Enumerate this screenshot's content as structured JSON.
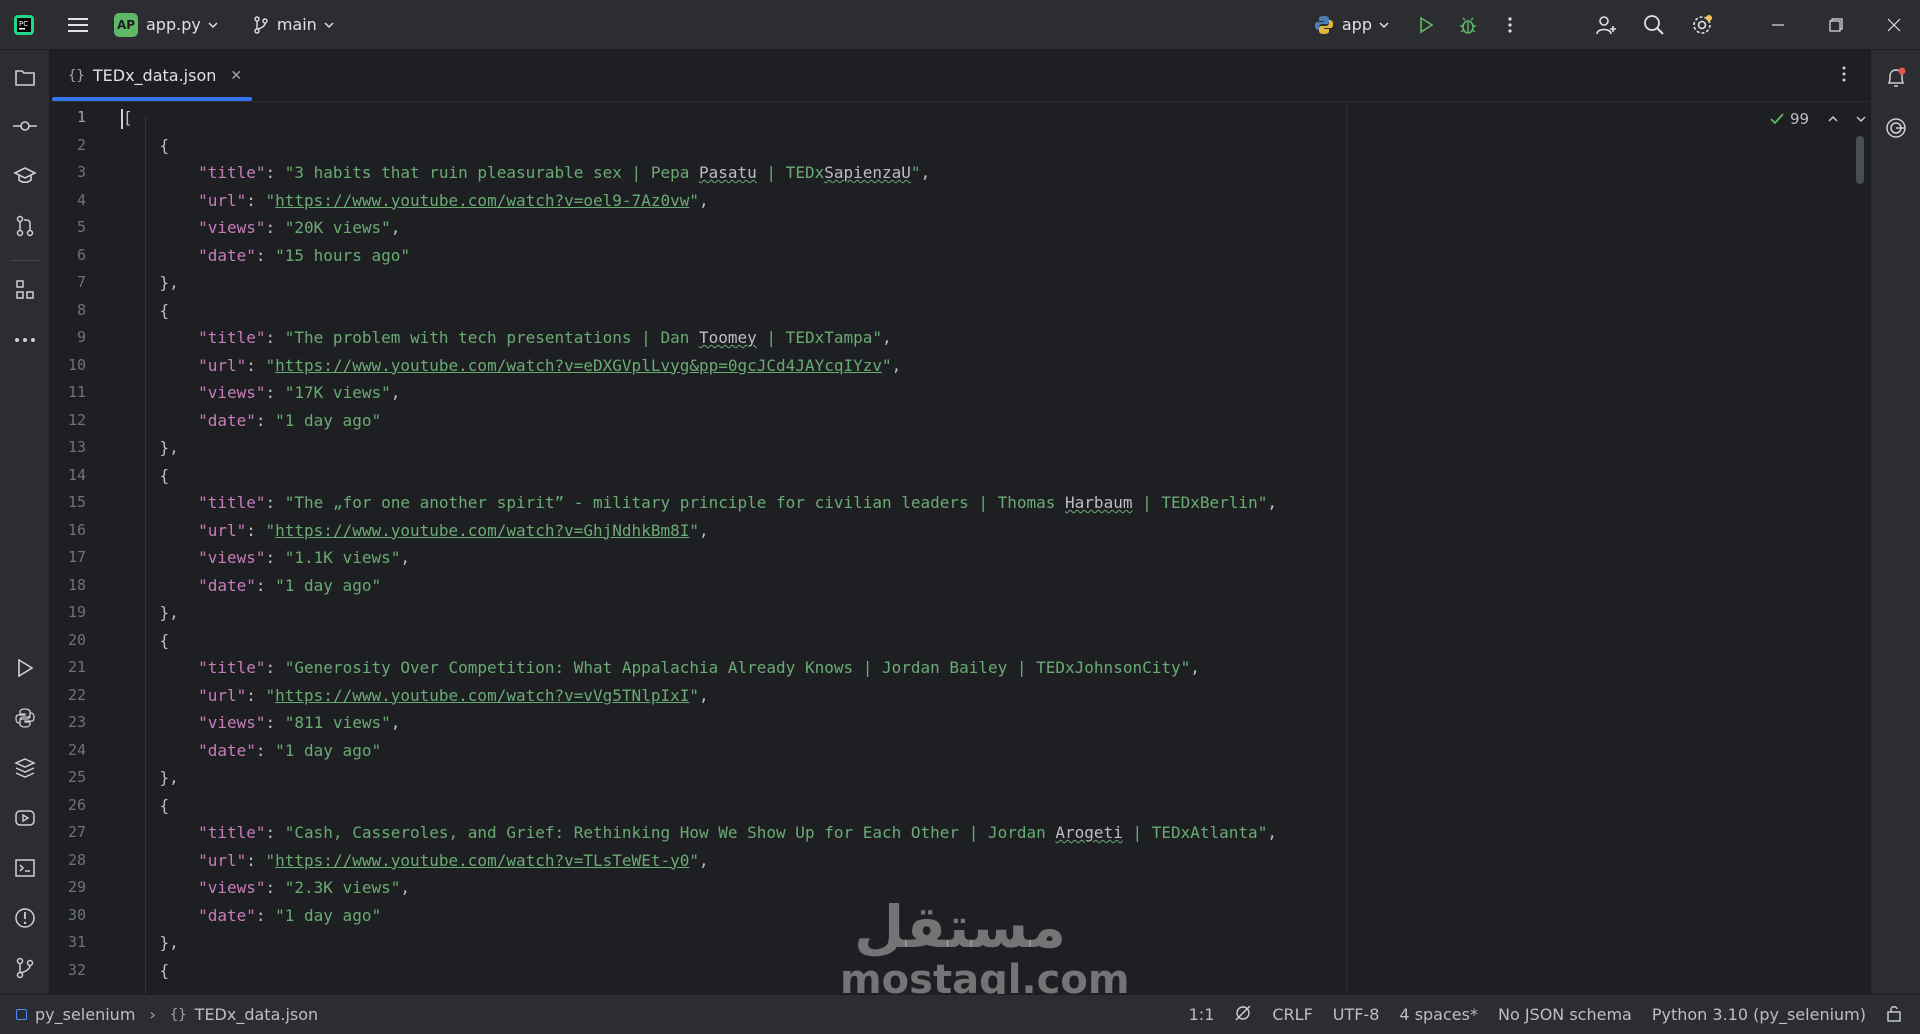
{
  "titlebar": {
    "project_badge": "AP",
    "project_file": "app.py",
    "branch": "main",
    "run_config": "app"
  },
  "tab": {
    "filename": "TEDx_data.json"
  },
  "inspection": {
    "count": "99"
  },
  "lines": [
    [
      [
        "p",
        "["
      ]
    ],
    [
      [
        "p",
        "    {"
      ]
    ],
    [
      [
        "p",
        "        "
      ],
      [
        "key",
        "\"title\""
      ],
      [
        "p",
        ": "
      ],
      [
        "str",
        "\"3 habits that ruin pleasurable sex | Pepa "
      ],
      [
        "typo",
        "Pasatu"
      ],
      [
        "str",
        " | TEDx"
      ],
      [
        "typo",
        "SapienzaU"
      ],
      [
        "str",
        "\""
      ],
      [
        "p",
        ","
      ]
    ],
    [
      [
        "p",
        "        "
      ],
      [
        "key",
        "\"url\""
      ],
      [
        "p",
        ": "
      ],
      [
        "str",
        "\""
      ],
      [
        "url",
        "https://www.youtube.com/watch?v=oel9-7Az0vw"
      ],
      [
        "str",
        "\""
      ],
      [
        "p",
        ","
      ]
    ],
    [
      [
        "p",
        "        "
      ],
      [
        "key",
        "\"views\""
      ],
      [
        "p",
        ": "
      ],
      [
        "str",
        "\"20K views\""
      ],
      [
        "p",
        ","
      ]
    ],
    [
      [
        "p",
        "        "
      ],
      [
        "key",
        "\"date\""
      ],
      [
        "p",
        ": "
      ],
      [
        "str",
        "\"15 hours ago\""
      ]
    ],
    [
      [
        "p",
        "    },"
      ]
    ],
    [
      [
        "p",
        "    {"
      ]
    ],
    [
      [
        "p",
        "        "
      ],
      [
        "key",
        "\"title\""
      ],
      [
        "p",
        ": "
      ],
      [
        "str",
        "\"The problem with tech presentations | Dan "
      ],
      [
        "typo",
        "Toomey"
      ],
      [
        "str",
        " | TEDxTampa\""
      ],
      [
        "p",
        ","
      ]
    ],
    [
      [
        "p",
        "        "
      ],
      [
        "key",
        "\"url\""
      ],
      [
        "p",
        ": "
      ],
      [
        "str",
        "\""
      ],
      [
        "url",
        "https://www.youtube.com/watch?v=eDXGVplLvyg&pp=0gcJCd4JAYcqIYzv"
      ],
      [
        "str",
        "\""
      ],
      [
        "p",
        ","
      ]
    ],
    [
      [
        "p",
        "        "
      ],
      [
        "key",
        "\"views\""
      ],
      [
        "p",
        ": "
      ],
      [
        "str",
        "\"17K views\""
      ],
      [
        "p",
        ","
      ]
    ],
    [
      [
        "p",
        "        "
      ],
      [
        "key",
        "\"date\""
      ],
      [
        "p",
        ": "
      ],
      [
        "str",
        "\"1 day ago\""
      ]
    ],
    [
      [
        "p",
        "    },"
      ]
    ],
    [
      [
        "p",
        "    {"
      ]
    ],
    [
      [
        "p",
        "        "
      ],
      [
        "key",
        "\"title\""
      ],
      [
        "p",
        ": "
      ],
      [
        "str",
        "\"The „for one another spirit” - military principle for civilian leaders | Thomas "
      ],
      [
        "typo",
        "Harbaum"
      ],
      [
        "str",
        " | TEDxBerlin\""
      ],
      [
        "p",
        ","
      ]
    ],
    [
      [
        "p",
        "        "
      ],
      [
        "key",
        "\"url\""
      ],
      [
        "p",
        ": "
      ],
      [
        "str",
        "\""
      ],
      [
        "url",
        "https://www.youtube.com/watch?v=GhjNdhkBm8I"
      ],
      [
        "str",
        "\""
      ],
      [
        "p",
        ","
      ]
    ],
    [
      [
        "p",
        "        "
      ],
      [
        "key",
        "\"views\""
      ],
      [
        "p",
        ": "
      ],
      [
        "str",
        "\"1.1K views\""
      ],
      [
        "p",
        ","
      ]
    ],
    [
      [
        "p",
        "        "
      ],
      [
        "key",
        "\"date\""
      ],
      [
        "p",
        ": "
      ],
      [
        "str",
        "\"1 day ago\""
      ]
    ],
    [
      [
        "p",
        "    },"
      ]
    ],
    [
      [
        "p",
        "    {"
      ]
    ],
    [
      [
        "p",
        "        "
      ],
      [
        "key",
        "\"title\""
      ],
      [
        "p",
        ": "
      ],
      [
        "str",
        "\"Generosity Over Competition: What Appalachia Already Knows | Jordan Bailey | TEDxJohnsonCity\""
      ],
      [
        "p",
        ","
      ]
    ],
    [
      [
        "p",
        "        "
      ],
      [
        "key",
        "\"url\""
      ],
      [
        "p",
        ": "
      ],
      [
        "str",
        "\""
      ],
      [
        "url",
        "https://www.youtube.com/watch?v=vVg5TNlpIxI"
      ],
      [
        "str",
        "\""
      ],
      [
        "p",
        ","
      ]
    ],
    [
      [
        "p",
        "        "
      ],
      [
        "key",
        "\"views\""
      ],
      [
        "p",
        ": "
      ],
      [
        "str",
        "\"811 views\""
      ],
      [
        "p",
        ","
      ]
    ],
    [
      [
        "p",
        "        "
      ],
      [
        "key",
        "\"date\""
      ],
      [
        "p",
        ": "
      ],
      [
        "str",
        "\"1 day ago\""
      ]
    ],
    [
      [
        "p",
        "    },"
      ]
    ],
    [
      [
        "p",
        "    {"
      ]
    ],
    [
      [
        "p",
        "        "
      ],
      [
        "key",
        "\"title\""
      ],
      [
        "p",
        ": "
      ],
      [
        "str",
        "\"Cash, Casseroles, and Grief: Rethinking How We Show Up for Each Other | Jordan "
      ],
      [
        "typo",
        "Arogeti"
      ],
      [
        "str",
        " | TEDxAtlanta\""
      ],
      [
        "p",
        ","
      ]
    ],
    [
      [
        "p",
        "        "
      ],
      [
        "key",
        "\"url\""
      ],
      [
        "p",
        ": "
      ],
      [
        "str",
        "\""
      ],
      [
        "url",
        "https://www.youtube.com/watch?v=TLsTeWEt-y0"
      ],
      [
        "str",
        "\""
      ],
      [
        "p",
        ","
      ]
    ],
    [
      [
        "p",
        "        "
      ],
      [
        "key",
        "\"views\""
      ],
      [
        "p",
        ": "
      ],
      [
        "str",
        "\"2.3K views\""
      ],
      [
        "p",
        ","
      ]
    ],
    [
      [
        "p",
        "        "
      ],
      [
        "key",
        "\"date\""
      ],
      [
        "p",
        ": "
      ],
      [
        "str",
        "\"1 day ago\""
      ]
    ],
    [
      [
        "p",
        "    },"
      ]
    ],
    [
      [
        "p",
        "    {"
      ]
    ]
  ],
  "statusbar": {
    "project": "py_selenium",
    "file": "TEDx_data.json",
    "position": "1:1",
    "line_ending": "CRLF",
    "encoding": "UTF-8",
    "indent": "4 spaces*",
    "schema": "No JSON schema",
    "interpreter": "Python 3.10 (py_selenium)"
  },
  "watermark": {
    "arabic": "مستقل",
    "latin": "mostaql.com"
  },
  "colors": {
    "background": "#1e1f22",
    "panel": "#2b2d30",
    "key": "#c77dbb",
    "string": "#6aab73",
    "accent": "#3574f0"
  }
}
